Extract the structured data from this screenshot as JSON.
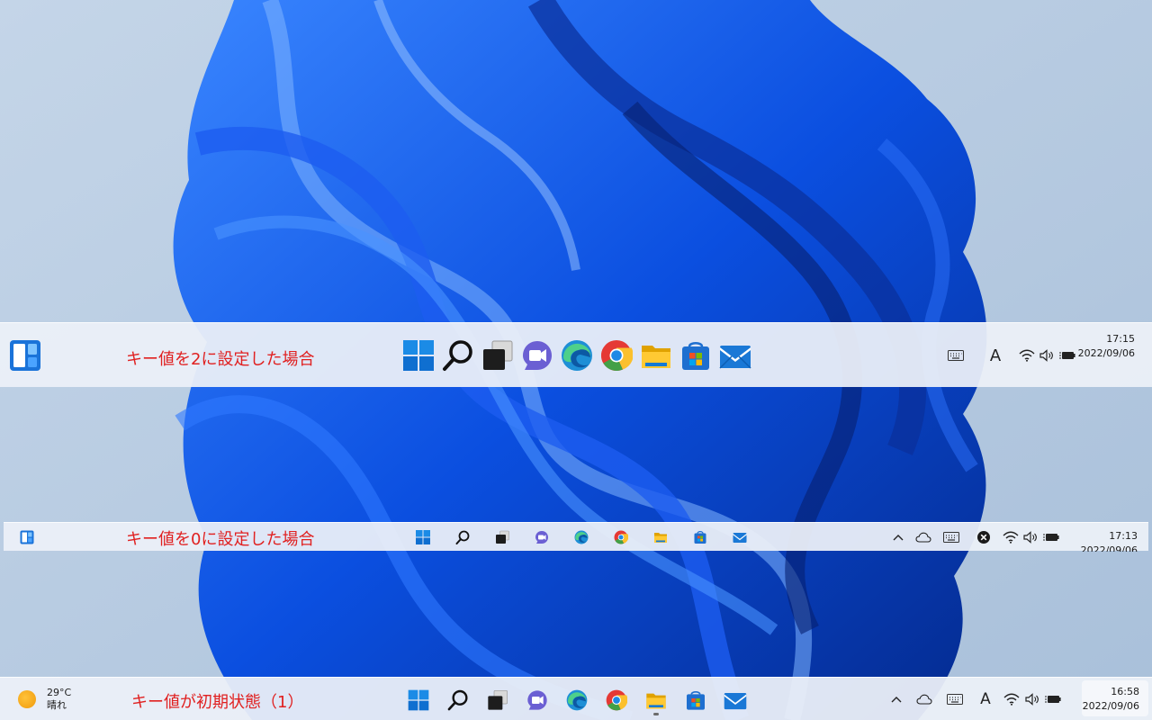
{
  "taskbars": {
    "large": {
      "annotation": "キー値を2に設定した場合",
      "clock": {
        "time": "17:15",
        "date": "2022/09/06"
      },
      "ime_label": "A"
    },
    "small": {
      "annotation": "キー値を0に設定した場合",
      "clock": {
        "time": "17:13",
        "date": "2022/09/06"
      }
    },
    "medium": {
      "annotation": "キー値が初期状態（1）",
      "weather": {
        "temperature": "29°C",
        "condition": "晴れ"
      },
      "clock": {
        "time": "16:58",
        "date": "2022/09/06"
      },
      "ime_label": "A"
    }
  },
  "pinned_apps": [
    "start-icon",
    "search-icon",
    "task-view-icon",
    "teams-chat-icon",
    "edge-icon",
    "chrome-icon",
    "file-explorer-icon",
    "microsoft-store-icon",
    "mail-icon"
  ],
  "colors": {
    "annotation": "#e02020",
    "taskbar_bg": "#eef1f8",
    "accent_blue": "#0a66d8"
  }
}
